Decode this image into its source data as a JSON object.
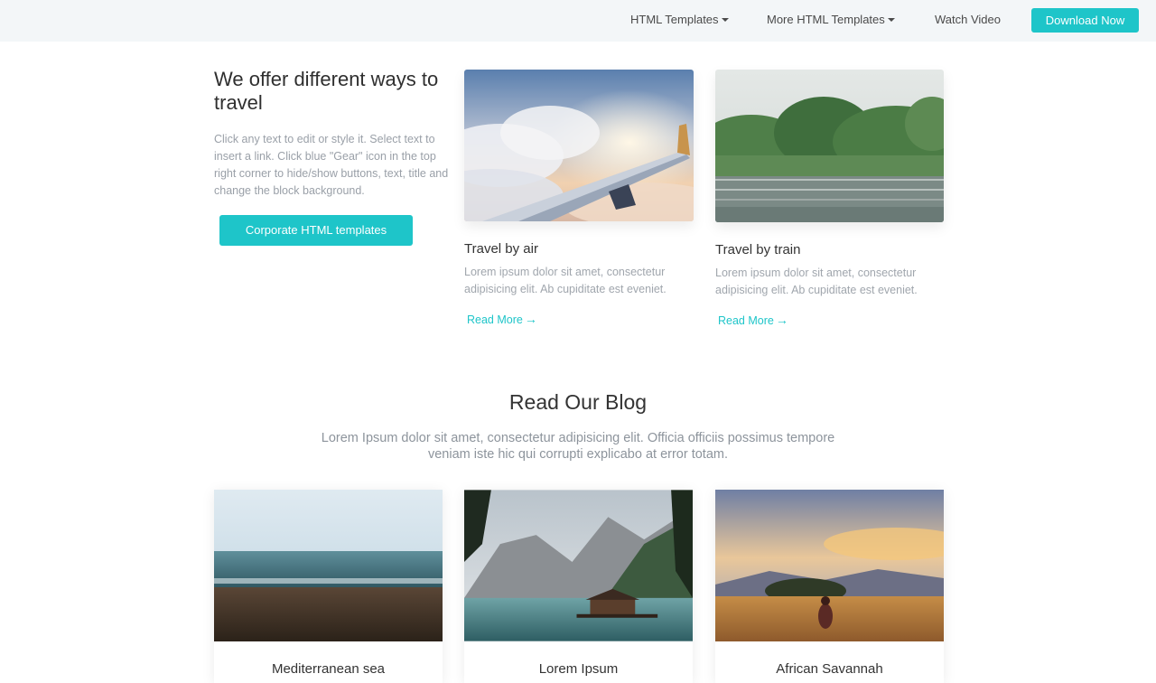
{
  "nav": {
    "items": [
      {
        "label": "HTML Templates",
        "has_dropdown": true
      },
      {
        "label": "More HTML Templates",
        "has_dropdown": true
      },
      {
        "label": "Watch Video",
        "has_dropdown": false
      }
    ],
    "cta_label": "Download Now",
    "bar_color": "#f3f6f8",
    "accent_color": "#1ec5c9"
  },
  "intro": {
    "title": "We offer different ways to travel",
    "text": "Click any text to edit or style it. Select text to insert a link. Click blue \"Gear\" icon in the top right corner to hide/show buttons, text, title and change the block background.",
    "button_label": "Corporate HTML templates"
  },
  "travel_cards": [
    {
      "title": "Travel by air",
      "text": "Lorem ipsum dolor sit amet, consectetur adipisicing elit. Ab cupiditate est eveniet.",
      "link": "Read More",
      "image": "airplane-wing-above-clouds"
    },
    {
      "title": "Travel by train",
      "text": "Lorem ipsum dolor sit amet, consectetur adipisicing elit. Ab cupiditate est eveniet.",
      "link": "Read More",
      "image": "railway-track-with-green-trees"
    }
  ],
  "blog": {
    "title": "Read Our Blog",
    "subtitle": "Lorem Ipsum dolor sit amet, consectetur adipisicing elit. Officia officiis possimus tempore veniam iste hic qui corrupti explicabo at error totam.",
    "cards": [
      {
        "title": "Mediterranean sea",
        "image": "sea-shore-at-dusk"
      },
      {
        "title": "Lorem Ipsum",
        "image": "mountain-lake-with-boathouse"
      },
      {
        "title": "African Savannah",
        "image": "savannah-field-at-sunset"
      }
    ]
  }
}
